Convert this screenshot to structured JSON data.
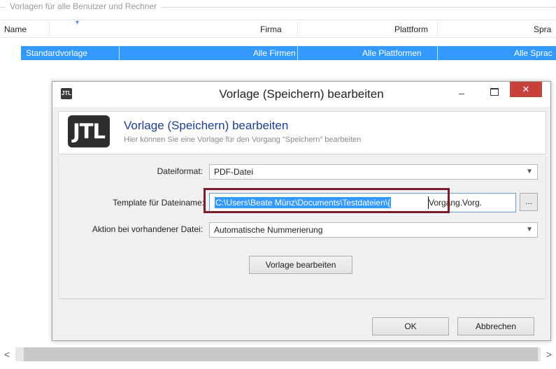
{
  "background": {
    "group_caption": "Vorlagen für alle Benutzer und Rechner",
    "columns": [
      "Name",
      "Firma",
      "Plattform",
      "Spra"
    ],
    "row": {
      "name": "Standardvorlage",
      "firma": "Alle Firmen",
      "plattform": "Alle Plattformen",
      "sprache": "Alle Sprac"
    },
    "scroll_left": "<",
    "scroll_right": ">"
  },
  "dialog": {
    "title": "Vorlage (Speichern) bearbeiten",
    "icon_text": "JTL",
    "min_glyph": "–",
    "close_glyph": "✕",
    "header": {
      "logo_text": "JTL",
      "title": "Vorlage (Speichern) bearbeiten",
      "subtitle": "Hier können Sie eine Vorlage für den Vorgang \"Speichern\" bearbeiten"
    },
    "fields": {
      "dateiformat_label": "Dateiformat:",
      "dateiformat_value": "PDF-Datei",
      "template_label": "Template für Dateiname:",
      "template_selected": "C:\\Users\\Beate Münz\\Documents\\Testdateien\\{",
      "template_rest": "Vorgang.Vorg.",
      "browse_label": "...",
      "aktion_label": "Aktion bei vorhandener Datei:",
      "aktion_value": "Automatische Nummerierung"
    },
    "edit_button": "Vorlage bearbeiten",
    "ok_button": "OK",
    "cancel_button": "Abbrechen"
  },
  "colors": {
    "selection": "#3399ff",
    "close_button": "#c7413b",
    "highlight_border": "#7b1c2a",
    "header_title": "#1f3f8c"
  }
}
